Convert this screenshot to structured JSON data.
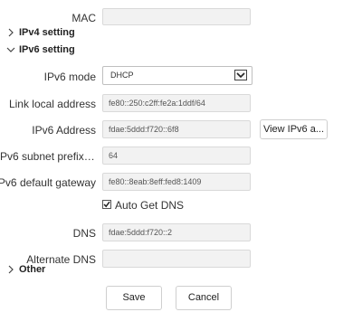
{
  "mac": {
    "label": "MAC",
    "value": ""
  },
  "sections": {
    "ipv4": "IPv4 setting",
    "ipv6": "IPv6 setting",
    "other": "Other"
  },
  "ipv6": {
    "mode_label": "IPv6 mode",
    "mode_value": "DHCP",
    "link_local_label": "Link local address",
    "link_local_value": "fe80::250:c2ff:fe2a:1ddf/64",
    "address_label": "IPv6 Address",
    "address_value": "fdae:5ddd:f720::6f8",
    "view_button": "View IPv6 a...",
    "prefix_label": "Pv6 subnet prefix len...",
    "prefix_value": "64",
    "gateway_label": "IPv6 default gateway",
    "gateway_value": "fe80::8eab:8eff:fed8:1409",
    "auto_dns_label": "Auto Get DNS",
    "auto_dns_checked": true,
    "dns_label": "DNS",
    "dns_value": "fdae:5ddd:f720::2",
    "alt_dns_label": "Alternate DNS",
    "alt_dns_value": ""
  },
  "actions": {
    "save": "Save",
    "cancel": "Cancel"
  },
  "icons": {
    "collapsed": "chevron-right-icon",
    "expanded": "chevron-down-icon",
    "select_arrow": "chevron-down-icon",
    "check": "checkmark-icon"
  }
}
